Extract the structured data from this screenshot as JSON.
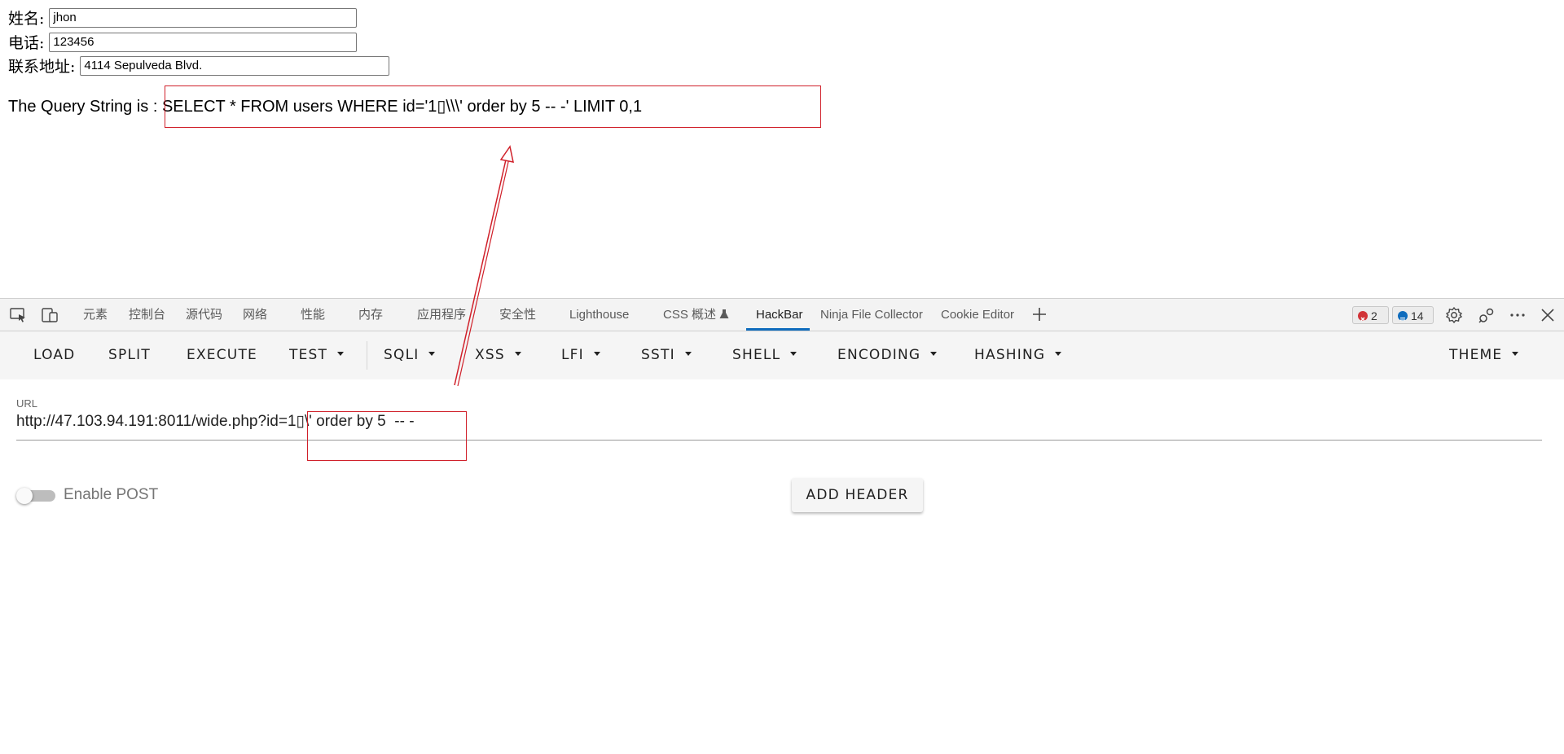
{
  "form": {
    "name_label": "姓名:",
    "name_value": "jhon",
    "phone_label": "电话:",
    "phone_value": "123456",
    "address_label": "联系地址:",
    "address_value": "4114 Sepulveda Blvd."
  },
  "query": {
    "prefix": "The Query String is : ",
    "sql": "SELECT * FROM users WHERE id='1▯\\\\\\' order by 5 -- -' LIMIT 0,1"
  },
  "devtools": {
    "tabs": [
      "元素",
      "控制台",
      "源代码",
      "网络",
      "性能",
      "内存",
      "应用程序",
      "安全性",
      "Lighthouse",
      "CSS 概述",
      "HackBar",
      "Ninja File Collector",
      "Cookie Editor"
    ],
    "active_tab": "HackBar",
    "errors_count": "2",
    "messages_count": "14",
    "colors": {
      "active_underline": "#0f6cbd",
      "error": "#d13438",
      "info": "#0f6cbd",
      "annotation": "#d0202a"
    }
  },
  "hackbar": {
    "buttons": [
      "LOAD",
      "SPLIT",
      "EXECUTE",
      "TEST",
      "SQLI",
      "XSS",
      "LFI",
      "SSTI",
      "SHELL",
      "ENCODING",
      "HASHING",
      "THEME"
    ],
    "url_label": "URL",
    "url_value": "http://47.103.94.191:8011/wide.php?id=1▯\\' order by 5  -- -",
    "enable_post_label": "Enable POST",
    "enable_post_on": false,
    "add_header_label": "ADD HEADER"
  }
}
